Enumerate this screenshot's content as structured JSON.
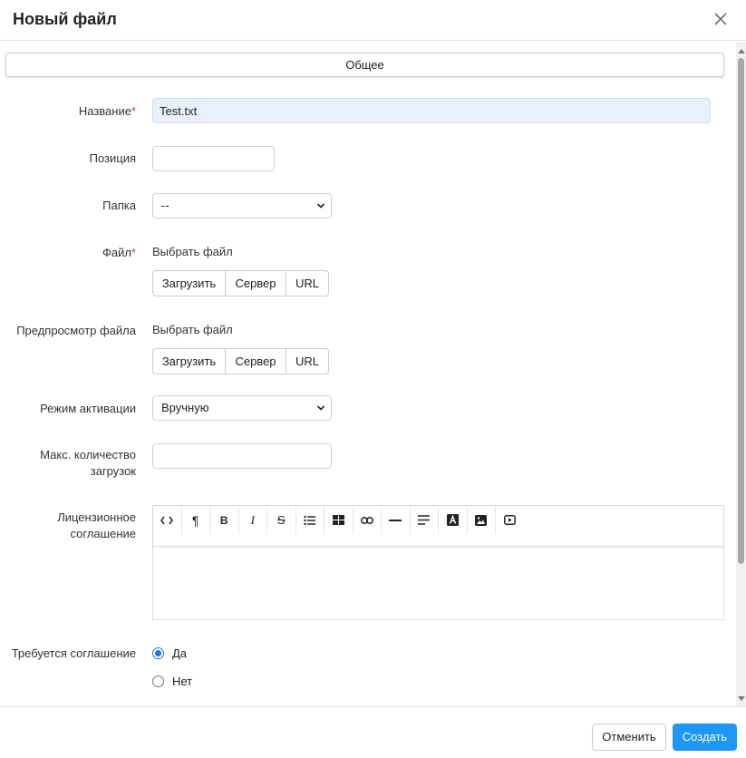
{
  "dialog": {
    "title": "Новый файл"
  },
  "tabs": [
    {
      "label": "Общее"
    }
  ],
  "form": {
    "name": {
      "label": "Название",
      "required_mark": "*",
      "value": "Test.txt"
    },
    "position": {
      "label": "Позиция",
      "value": ""
    },
    "folder": {
      "label": "Папка",
      "selected": "--"
    },
    "file": {
      "label": "Файл",
      "required_mark": "*",
      "picker_text": "Выбрать файл",
      "buttons": [
        "Загрузить",
        "Сервер",
        "URL"
      ]
    },
    "preview": {
      "label": "Предпросмотр файла",
      "picker_text": "Выбрать файл",
      "buttons": [
        "Загрузить",
        "Сервер",
        "URL"
      ]
    },
    "activation": {
      "label": "Режим активации",
      "selected": "Вручную"
    },
    "max_downloads": {
      "label_line1": "Макс. количество",
      "label_line2": "загрузок",
      "value": ""
    },
    "license": {
      "label_line1": "Лицензионное",
      "label_line2": "соглашение",
      "toolbar_icons": [
        "code-view-icon",
        "paragraph-icon",
        "bold-icon",
        "italic-icon",
        "strikethrough-icon",
        "list-icon",
        "table-icon",
        "link-icon",
        "horizontal-rule-icon",
        "align-icon",
        "font-color-icon",
        "image-icon",
        "video-icon"
      ]
    },
    "agreement": {
      "label": "Требуется соглашение",
      "options": [
        "Да",
        "Нет"
      ],
      "selected": "Да"
    }
  },
  "footer": {
    "cancel_label": "Отменить",
    "create_label": "Создать"
  },
  "colors": {
    "primary": "#1c97f3",
    "required": "#d9363e",
    "filled_input": "#e8f0fe"
  }
}
